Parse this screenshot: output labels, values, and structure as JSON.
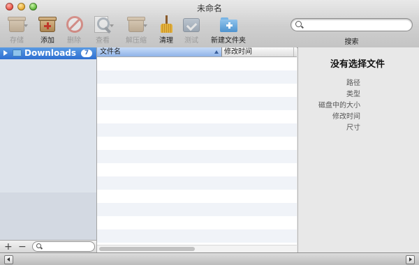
{
  "window": {
    "title": "未命名"
  },
  "toolbar": {
    "archive": "存储",
    "add": "添加",
    "remove": "删除",
    "view": "查看",
    "extract": "解压缩",
    "clean": "清理",
    "test": "测试",
    "new_folder": "新建文件夹",
    "search_label": "搜索",
    "search_placeholder": ""
  },
  "icons": {
    "archive": "box-icon",
    "add": "box-plus-icon",
    "remove": "no-sign-icon",
    "view": "magnifier-icon",
    "extract": "box-down-icon",
    "clean": "broom-icon",
    "test": "checkmark-icon",
    "new_folder": "folder-plus-icon"
  },
  "sidebar": {
    "items": [
      {
        "label": "Downloads",
        "count": "7"
      }
    ],
    "add_button": "+",
    "remove_button": "−",
    "filter_placeholder": ""
  },
  "file_list": {
    "columns": [
      "文件名",
      "修改时间"
    ],
    "rows": []
  },
  "info": {
    "title": "没有选择文件",
    "fields": [
      "路径",
      "类型",
      "磁盘中的大小",
      "修改时间",
      "尺寸"
    ]
  },
  "colors": {
    "selection": "#2e6fd1",
    "sidebar_bg": "#dde3eb",
    "row_alt": "#f0f3f8"
  }
}
